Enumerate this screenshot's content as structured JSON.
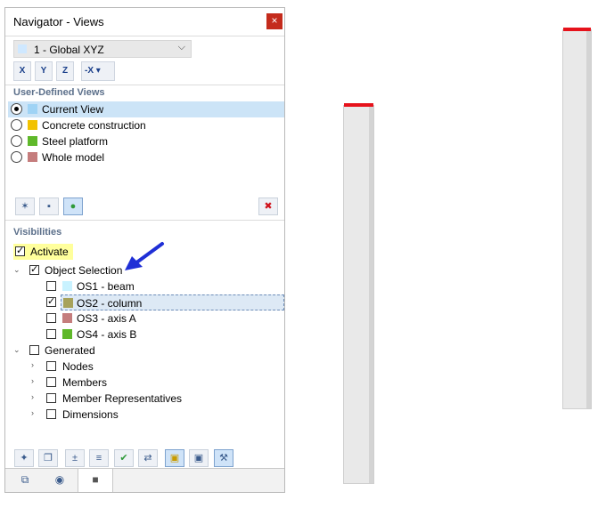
{
  "window": {
    "title": "Navigator - Views",
    "close": "×"
  },
  "combo": {
    "value": "1 - Global XYZ",
    "swatch": "#cfe8ff"
  },
  "axis_buttons": [
    "X",
    "Y",
    "Z",
    "-X"
  ],
  "user_views": {
    "header": "User-Defined Views",
    "items": [
      {
        "label": "Current View",
        "color": "#9fd3f5",
        "selected": true
      },
      {
        "label": "Concrete construction",
        "color": "#f2c200",
        "selected": false
      },
      {
        "label": "Steel platform",
        "color": "#5fb82a",
        "selected": false
      },
      {
        "label": "Whole model",
        "color": "#c57d7d",
        "selected": false
      }
    ]
  },
  "visibilities": {
    "header": "Visibilities",
    "activate": {
      "label": "Activate",
      "checked": true
    },
    "object_selection": {
      "label": "Object Selection",
      "checked": true,
      "items": [
        {
          "label": "OS1 - beam",
          "color": "#c9f2ff",
          "checked": false
        },
        {
          "label": "OS2 - column",
          "color": "#a7a25a",
          "checked": true
        },
        {
          "label": "OS3 - axis A",
          "color": "#c57d7d",
          "checked": false
        },
        {
          "label": "OS4 - axis B",
          "color": "#5fb82a",
          "checked": false
        }
      ]
    },
    "generated": {
      "label": "Generated",
      "checked": false,
      "items": [
        {
          "label": "Nodes"
        },
        {
          "label": "Members"
        },
        {
          "label": "Member Representatives"
        },
        {
          "label": "Dimensions"
        }
      ]
    }
  },
  "tabs": [
    "data-icon",
    "eye-icon",
    "camera-icon"
  ],
  "colors": {
    "selection": "#cce4f7",
    "highlight": "#ffff9c",
    "arrow": "#1f2fd6",
    "column_top": "#e6121b"
  }
}
